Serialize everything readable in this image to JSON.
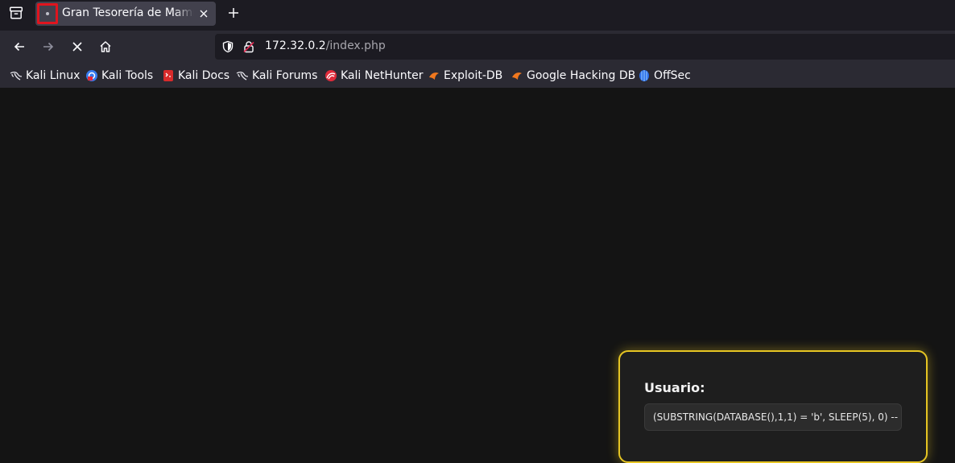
{
  "browser": {
    "tab": {
      "title": "Gran Tesorería de Mammon"
    },
    "url": {
      "host": "172.32.0.2",
      "path": "/index.php"
    },
    "bookmarks": [
      {
        "label": "Kali Linux",
        "icon": "kali-dragon-icon"
      },
      {
        "label": "Kali Tools",
        "icon": "kali-tools-icon"
      },
      {
        "label": "Kali Docs",
        "icon": "kali-docs-icon"
      },
      {
        "label": "Kali Forums",
        "icon": "kali-dragon-icon"
      },
      {
        "label": "Kali NetHunter",
        "icon": "nethunter-icon"
      },
      {
        "label": "Exploit-DB",
        "icon": "exploit-db-icon"
      },
      {
        "label": "Google Hacking DB",
        "icon": "exploit-db-icon"
      },
      {
        "label": "OffSec",
        "icon": "offsec-icon"
      }
    ]
  },
  "page": {
    "login": {
      "user_label": "Usuario:",
      "user_value": "(SUBSTRING(DATABASE(),1,1) = 'b', SLEEP(5), 0) -- "
    }
  },
  "colors": {
    "accent": "#e6c523",
    "tab_highlight": "#e0141e"
  }
}
